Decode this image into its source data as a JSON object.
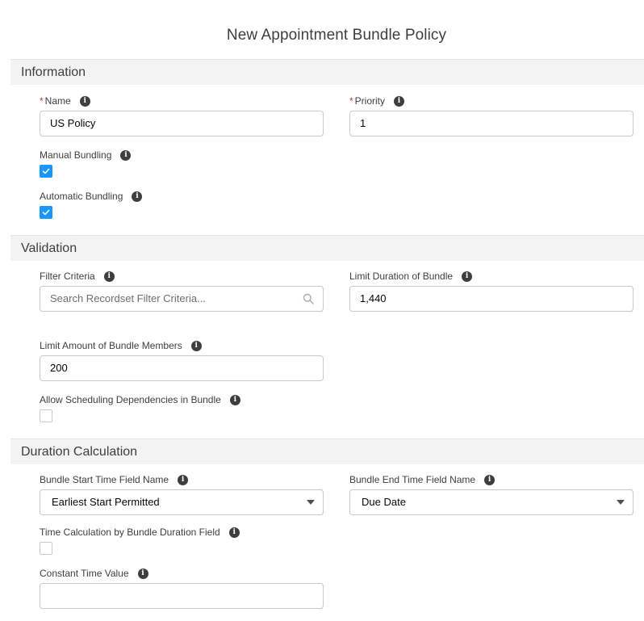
{
  "modal": {
    "title": "New Appointment Bundle Policy"
  },
  "sections": {
    "information": "Information",
    "validation": "Validation",
    "duration": "Duration Calculation"
  },
  "fields": {
    "name": {
      "label": "Name",
      "value": "US Policy",
      "required": true
    },
    "priority": {
      "label": "Priority",
      "value": "1",
      "required": true
    },
    "manual_bundling": {
      "label": "Manual Bundling",
      "checked": true
    },
    "automatic_bundling": {
      "label": "Automatic Bundling",
      "checked": true
    },
    "filter_criteria": {
      "label": "Filter Criteria",
      "placeholder": "Search Recordset Filter Criteria...",
      "value": ""
    },
    "limit_duration": {
      "label": "Limit Duration of Bundle",
      "value": "1,440"
    },
    "limit_amount": {
      "label": "Limit Amount of Bundle Members",
      "value": "200"
    },
    "allow_dependencies": {
      "label": "Allow Scheduling Dependencies in Bundle",
      "checked": false
    },
    "bundle_start": {
      "label": "Bundle Start Time Field Name",
      "value": "Earliest Start Permitted"
    },
    "bundle_end": {
      "label": "Bundle End Time Field Name",
      "value": "Due Date"
    },
    "time_calc": {
      "label": "Time Calculation by Bundle Duration Field",
      "checked": false
    },
    "constant_time": {
      "label": "Constant Time Value",
      "value": ""
    }
  },
  "icons": {
    "info": "info-icon",
    "search": "search-icon",
    "caret": "chevron-down-icon",
    "check": "check-icon"
  },
  "colors": {
    "required": "#c23934",
    "checkbox_checked": "#1b96ff",
    "section_bg": "#f3f3f3"
  }
}
